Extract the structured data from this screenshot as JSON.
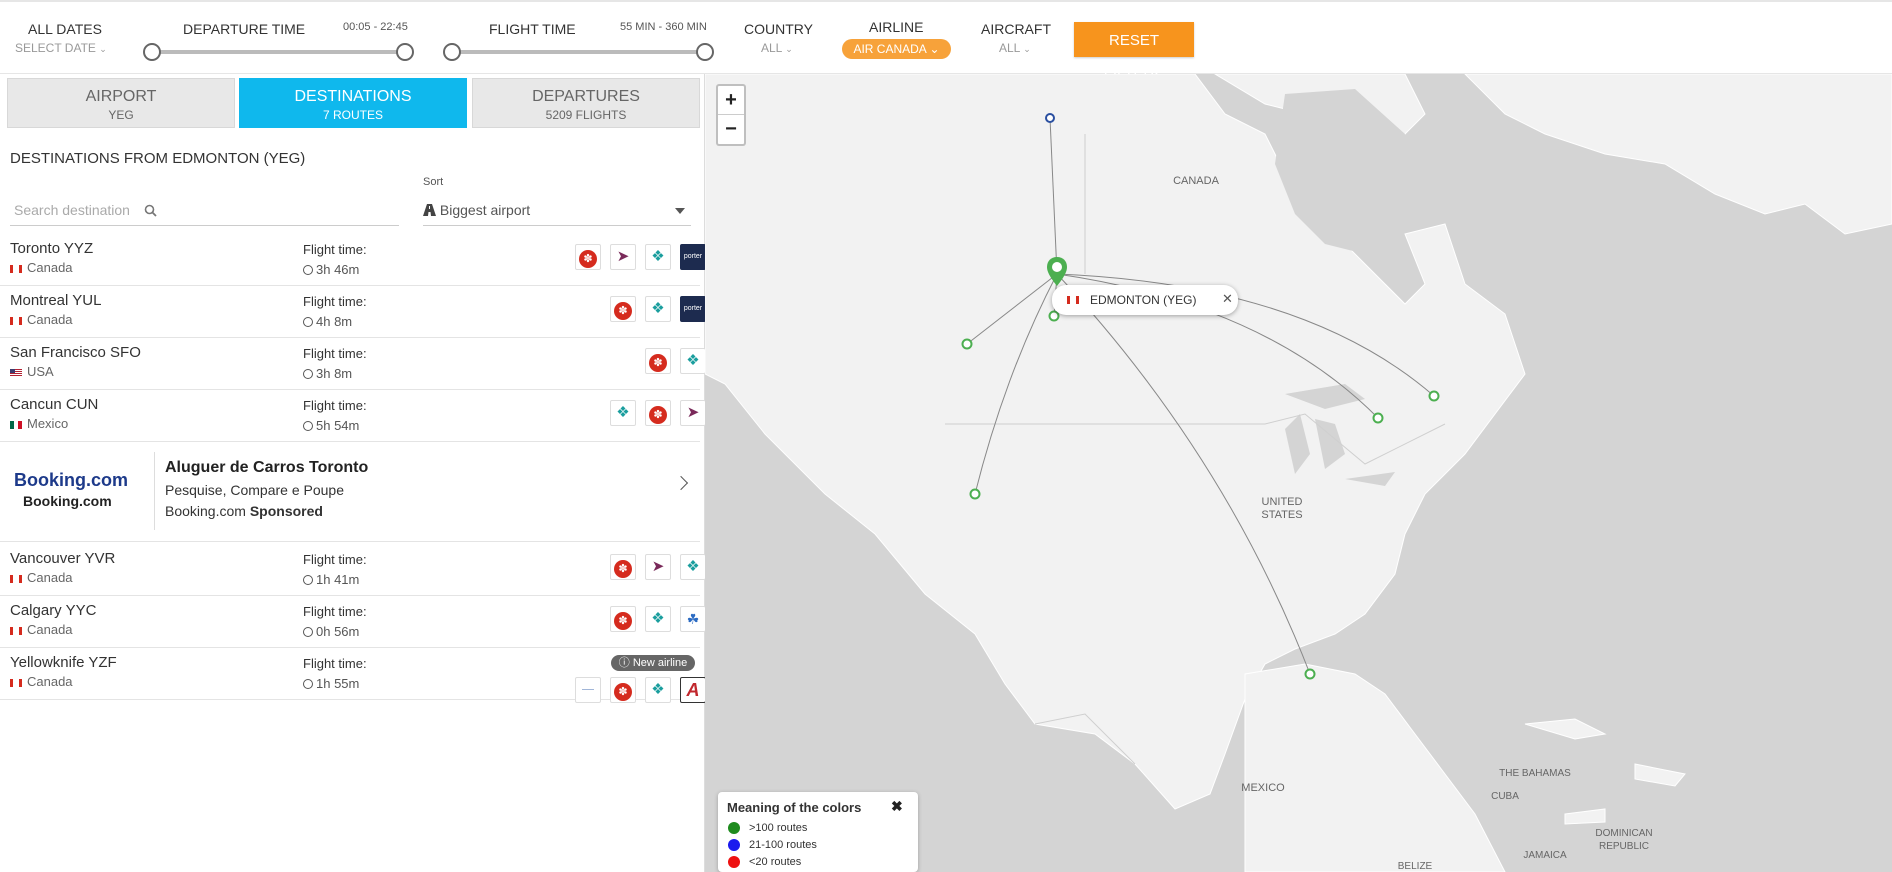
{
  "filters": {
    "dates": {
      "label": "ALL DATES",
      "value": "SELECT DATE"
    },
    "departure": {
      "label": "DEPARTURE TIME",
      "range": "00:05 - 22:45"
    },
    "flight_time": {
      "label": "FLIGHT TIME",
      "range": "55 MIN - 360 MIN"
    },
    "country": {
      "label": "COUNTRY",
      "value": "ALL"
    },
    "airline": {
      "label": "AIRLINE",
      "value": "AIR CANADA"
    },
    "aircraft": {
      "label": "AIRCRAFT",
      "value": "ALL"
    },
    "reset_label": "RESET FILTERS",
    "colors": {
      "accent": "#f7941d",
      "pill": "#f7a23a"
    }
  },
  "tabs": [
    {
      "title": "AIRPORT",
      "sub": "YEG"
    },
    {
      "title": "DESTINATIONS",
      "sub": "7 ROUTES"
    },
    {
      "title": "DEPARTURES",
      "sub": "5209 FLIGHTS"
    }
  ],
  "active_tab_color": "#0fb8ed",
  "panel": {
    "title": "DESTINATIONS FROM EDMONTON (YEG)",
    "sort_label": "Sort",
    "search_placeholder": "Search destination",
    "sort_value": "Biggest airport",
    "flight_time_label": "Flight time:"
  },
  "destinations": [
    {
      "name": "Toronto YYZ",
      "country": "Canada",
      "flag": "ca",
      "time": "3h 46m",
      "airlines": [
        "air-canada",
        "flair",
        "westjet",
        "porter"
      ]
    },
    {
      "name": "Montreal YUL",
      "country": "Canada",
      "flag": "ca",
      "time": "4h 8m",
      "airlines": [
        "air-canada",
        "westjet",
        "porter"
      ]
    },
    {
      "name": "San Francisco SFO",
      "country": "USA",
      "flag": "us",
      "time": "3h 8m",
      "airlines": [
        "air-canada",
        "westjet"
      ]
    },
    {
      "name": "Cancun CUN",
      "country": "Mexico",
      "flag": "mx",
      "time": "5h 54m",
      "airlines": [
        "westjet",
        "air-canada",
        "flair"
      ]
    },
    {
      "name": "Vancouver YVR",
      "country": "Canada",
      "flag": "ca",
      "time": "1h 41m",
      "airlines": [
        "air-canada",
        "flair",
        "westjet"
      ]
    },
    {
      "name": "Calgary YYC",
      "country": "Canada",
      "flag": "ca",
      "time": "0h 56m",
      "airlines": [
        "air-canada",
        "westjet",
        "canadian-north"
      ]
    },
    {
      "name": "Yellowknife YZF",
      "country": "Canada",
      "flag": "ca",
      "time": "1h 55m",
      "badge": "New airline",
      "airlines": [
        "canadian-north-2",
        "air-canada",
        "westjet",
        "northwestern-air"
      ]
    }
  ],
  "ad": {
    "logo": "Booking.com",
    "brand": "Booking.com",
    "title": "Aluguer de Carros Toronto",
    "desc": "Pesquise, Compare e Poupe",
    "source": "Booking.com",
    "sponsored": "Sponsored"
  },
  "map": {
    "zoom_in": "+",
    "zoom_out": "−",
    "labels": {
      "canada": "CANADA",
      "us1": "UNITED",
      "us2": "STATES",
      "mexico": "MEXICO",
      "bahamas": "THE BAHAMAS",
      "cuba": "CUBA",
      "dr1": "DOMINICAN",
      "dr2": "REPUBLIC",
      "jamaica": "JAMAICA",
      "belize": "BELIZE"
    },
    "popup": {
      "text": "EDMONTON (YEG)",
      "close": "✕"
    },
    "route_color": "#888888",
    "marker_color": "#4caf50"
  },
  "legend": {
    "title": "Meaning of the colors",
    "close": "✖",
    "items": [
      {
        "label": ">100 routes",
        "color": "#1e8b1e"
      },
      {
        "label": "21-100 routes",
        "color": "#1a1aee"
      },
      {
        "label": "<20 routes",
        "color": "#ee1111"
      }
    ]
  }
}
